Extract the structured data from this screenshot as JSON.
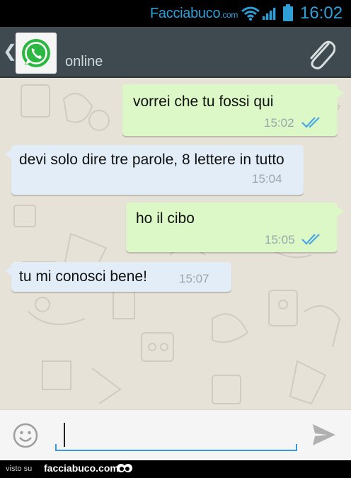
{
  "status_bar": {
    "brand": "Facciabuco",
    "brand_suffix": ".com",
    "time": "16:02",
    "icons": [
      "wifi-icon",
      "signal-icon",
      "battery-icon"
    ],
    "accent_color": "#2f9fd8"
  },
  "header": {
    "contact_status": "online",
    "avatar_icon": "whatsapp-logo-icon",
    "action_icon": "paperclip-icon",
    "back_icon": "chevron-left-icon",
    "background_color": "#3e4a50"
  },
  "messages": [
    {
      "direction": "outgoing",
      "text": "vorrei che tu fossi qui",
      "time": "15:02",
      "status": "read",
      "status_icon": "double-check-icon"
    },
    {
      "direction": "incoming",
      "text": "devi solo dire tre parole, 8 lettere in tutto",
      "time": "15:04"
    },
    {
      "direction": "outgoing",
      "text": "ho il cibo",
      "time": "15:05",
      "status": "read",
      "status_icon": "double-check-icon"
    },
    {
      "direction": "incoming",
      "text": "tu mi conosci bene!",
      "time": "15:07"
    }
  ],
  "composer": {
    "value": "",
    "emoji_icon": "smiley-icon",
    "send_icon": "send-icon",
    "accent_color": "#3a9ad9"
  },
  "footer": {
    "prefix": "visto su",
    "brand": "facciabuco.com"
  },
  "colors": {
    "outgoing_bubble": "#dcf8c6",
    "incoming_bubble": "#e3edf7",
    "chat_background": "#e7e2d8",
    "read_ticks": "#4aa7e3"
  }
}
